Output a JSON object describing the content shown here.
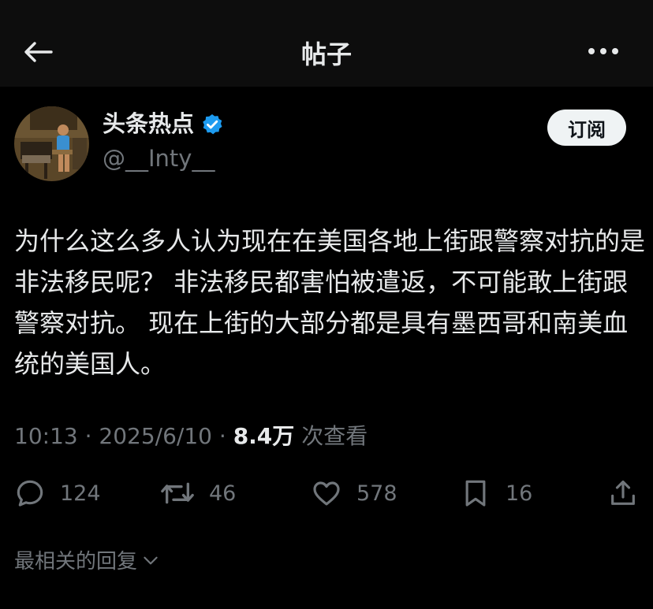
{
  "header": {
    "title": "帖子",
    "back_icon": "arrow-left-icon",
    "more_icon": "more-horizontal-icon"
  },
  "author": {
    "name": "头条热点",
    "handle": "@__Inty__",
    "verified_icon": "verified-badge-icon",
    "verified_color": "#1d9bf0"
  },
  "subscribe_label": "订阅",
  "post": {
    "text": "为什么这么多人认为现在在美国各地上街跟警察对抗的是非法移民呢？ 非法移民都害怕被遣返，不可能敢上街跟警察对抗。 现在上街的大部分都是具有墨西哥和南美血统的美国人。"
  },
  "meta": {
    "time": "10:13",
    "separator": " · ",
    "date": "2025/6/10",
    "views": "8.4万",
    "views_label": "次查看"
  },
  "actions": {
    "replies": "124",
    "reposts": "46",
    "likes": "578",
    "bookmarks": "16"
  },
  "replies_sort_label": "最相关的回复",
  "colors": {
    "background": "#000000",
    "text_primary": "#e7e9ea",
    "text_secondary": "#71767b",
    "button_bg": "#eff3f4"
  }
}
